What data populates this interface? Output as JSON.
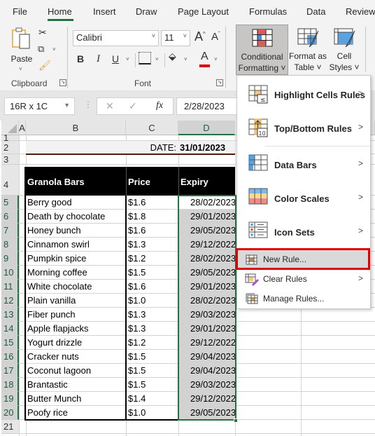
{
  "tabs": [
    "File",
    "Home",
    "Insert",
    "Draw",
    "Page Layout",
    "Formulas",
    "Data",
    "Review"
  ],
  "active_tab": "Home",
  "ribbon": {
    "clipboard": {
      "paste_label": "Paste",
      "group_label": "Clipboard"
    },
    "font": {
      "font_name": "Calibri",
      "font_size": "11",
      "group_label": "Font",
      "bold": "B",
      "italic": "I",
      "underline": "U",
      "grow": "A",
      "shrink": "A",
      "font_color": "A",
      "font_color_hex": "#e00000"
    },
    "styles": {
      "conditional_formatting": [
        "Conditional",
        "Formatting ˅"
      ],
      "format_as_table": [
        "Format as",
        "Table ˅"
      ],
      "cell_styles": [
        "Cell",
        "Styles ˅"
      ]
    }
  },
  "formula_bar": {
    "name_box": "16R x 1C",
    "cancel": "✕",
    "enter": "✓",
    "fx": "fx",
    "value": "2/28/2023"
  },
  "columns": [
    "A",
    "B",
    "C",
    "D"
  ],
  "selected_column": "D",
  "rows": [
    "1",
    "2",
    "3",
    "4",
    "5",
    "6",
    "7",
    "8",
    "9",
    "10",
    "11",
    "12",
    "13",
    "14",
    "15",
    "16",
    "17",
    "18",
    "19",
    "20",
    "21"
  ],
  "sheet": {
    "date_label": "DATE:",
    "date_value": "31/01/2023",
    "headers": [
      "Granola Bars",
      "Price",
      "Expiry"
    ],
    "data": [
      [
        "Berry good",
        "$1.6",
        "28/02/2023"
      ],
      [
        "Death by chocolate",
        "$1.8",
        "29/01/2023"
      ],
      [
        "Honey bunch",
        "$1.6",
        "29/05/2023"
      ],
      [
        "Cinnamon swirl",
        "$1.3",
        "29/12/2022"
      ],
      [
        "Pumpkin spice",
        "$1.2",
        "28/02/2023"
      ],
      [
        "Morning coffee",
        "$1.5",
        "29/05/2023"
      ],
      [
        "White chocolate",
        "$1.6",
        "29/01/2023"
      ],
      [
        "Plain vanilla",
        "$1.0",
        "28/02/2023"
      ],
      [
        "Fiber punch",
        "$1.3",
        "29/03/2023"
      ],
      [
        "Apple flapjacks",
        "$1.3",
        "29/01/2023"
      ],
      [
        "Yogurt drizzle",
        "$1.2",
        "29/12/2022"
      ],
      [
        "Cracker nuts",
        "$1.5",
        "29/04/2023"
      ],
      [
        "Coconut lagoon",
        "$1.5",
        "29/04/2023"
      ],
      [
        "Brantastic",
        "$1.5",
        "29/03/2023"
      ],
      [
        "Butter Munch",
        "$1.4",
        "29/12/2022"
      ],
      [
        "Poofy rice",
        "$1.0",
        "29/05/2023"
      ]
    ]
  },
  "menu": {
    "items": [
      {
        "label": "Highlight Cells Rules",
        "icon": "highlight-cells-icon",
        "submenu": true
      },
      {
        "label": "Top/Bottom Rules",
        "icon": "top-bottom-icon",
        "submenu": true
      },
      {
        "label": "Data Bars",
        "icon": "data-bars-icon",
        "submenu": true
      },
      {
        "label": "Color Scales",
        "icon": "color-scales-icon",
        "submenu": true
      },
      {
        "label": "Icon Sets",
        "icon": "icon-sets-icon",
        "submenu": true
      },
      {
        "label": "New Rule...",
        "icon": "new-rule-icon",
        "submenu": false,
        "highlighted": true
      },
      {
        "label": "Clear Rules",
        "icon": "clear-rules-icon",
        "submenu": true
      },
      {
        "label": "Manage Rules...",
        "icon": "manage-rules-icon",
        "submenu": false
      }
    ],
    "arrow": ">"
  },
  "colors": {
    "accent": "#217346",
    "highlight_box": "#e00000",
    "selection_fill": "#d2d2d2"
  }
}
